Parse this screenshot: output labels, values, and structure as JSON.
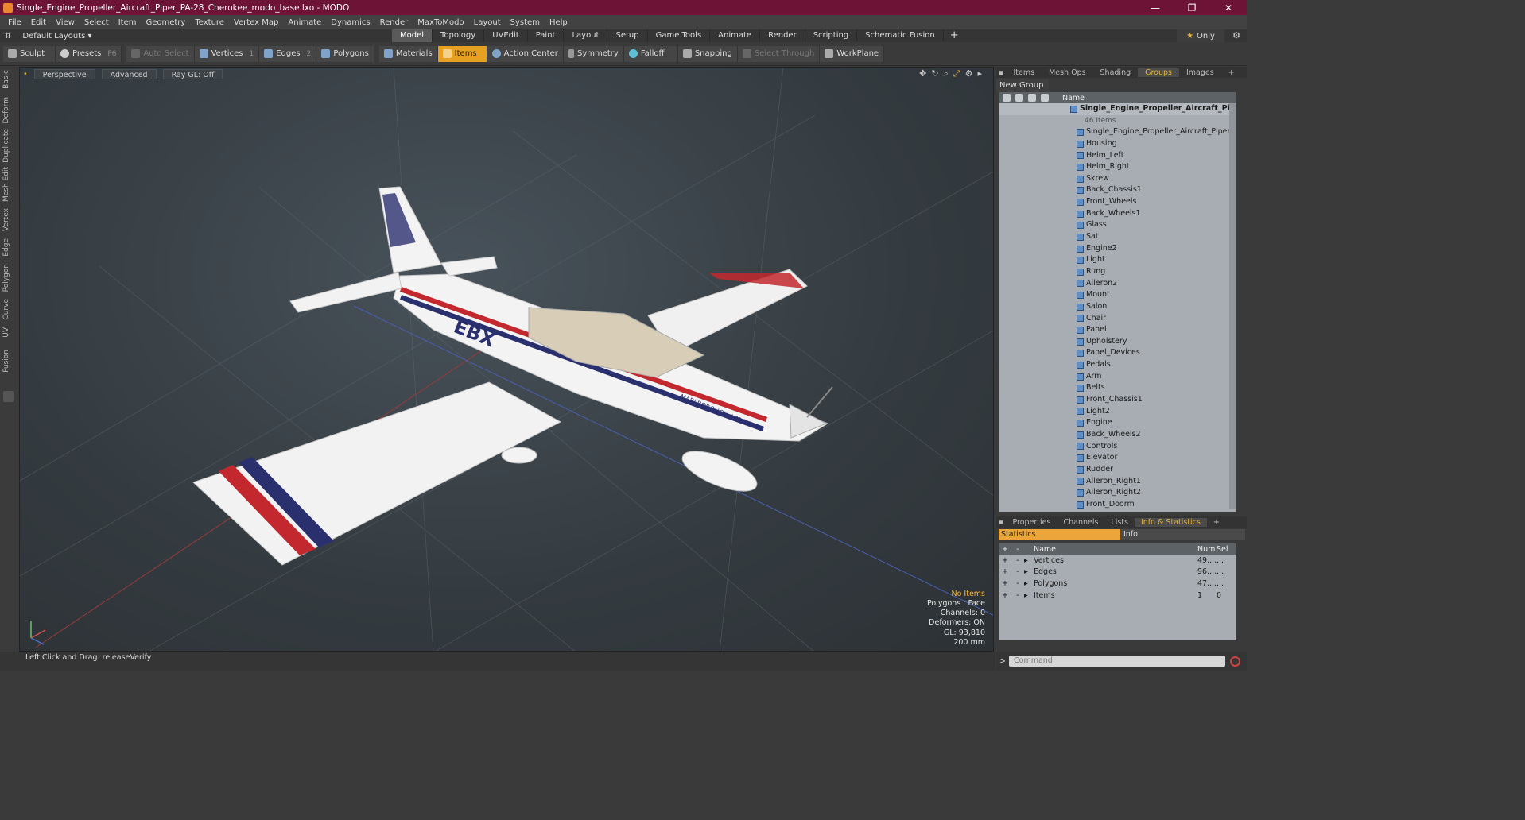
{
  "window": {
    "title": "Single_Engine_Propeller_Aircraft_Piper_PA-28_Cherokee_modo_base.lxo - MODO",
    "minimize": "—",
    "maximize": "❐",
    "close": "✕"
  },
  "menu": [
    "File",
    "Edit",
    "View",
    "Select",
    "Item",
    "Geometry",
    "Texture",
    "Vertex Map",
    "Animate",
    "Dynamics",
    "Render",
    "MaxToModo",
    "Layout",
    "System",
    "Help"
  ],
  "layouts": {
    "label": "Default Layouts ▾"
  },
  "tabs": [
    "Model",
    "Topology",
    "UVEdit",
    "Paint",
    "Layout",
    "Setup",
    "Game Tools",
    "Animate",
    "Render",
    "Scripting",
    "Schematic Fusion"
  ],
  "tab_add": "+",
  "only": {
    "star": "★",
    "label": "Only"
  },
  "toolbar": {
    "sculpt": "Sculpt",
    "presets": "Presets",
    "presets_key": "F6",
    "auto_select": "Auto Select",
    "vertices": "Vertices",
    "vertices_key": "1",
    "edges": "Edges",
    "edges_key": "2",
    "polygons": "Polygons",
    "materials": "Materials",
    "items": "Items",
    "action_center": "Action Center",
    "symmetry": "Symmetry",
    "falloff": "Falloff",
    "snapping": "Snapping",
    "select_through": "Select Through",
    "workplane": "WorkPlane"
  },
  "left_tabs": [
    "Basic",
    "Deform",
    "Duplicate",
    "Mesh Edit",
    "Vertex",
    "Edge",
    "Polygon",
    "Curve",
    "UV",
    "Fusion"
  ],
  "viewport": {
    "view": "Perspective",
    "mode": "Advanced",
    "raygl": "Ray GL: Off",
    "aircraft_reg": "EBX",
    "aircraft_club": "MARLBOROUGH AERO CLUB",
    "stats": {
      "items": "No Items",
      "polygons": "Polygons : Face",
      "channels": "Channels: 0",
      "deformers": "Deformers: ON",
      "gl": "GL: 93,810",
      "scale": "200 mm"
    }
  },
  "status": {
    "hint": "Left Click and Drag:  releaseVerify"
  },
  "panel_tabs": [
    "Items",
    "Mesh Ops",
    "Shading",
    "Groups",
    "Images"
  ],
  "panel_active": "Groups",
  "new_group": "New Group",
  "list_header": {
    "name": "Name"
  },
  "groups": {
    "root": "Single_Engine_Propeller_Aircraft_Piper ...",
    "root_count": "46 Items",
    "items": [
      "Single_Engine_Propeller_Aircraft_Piper_PA_...",
      "Housing",
      "Helm_Left",
      "Helm_Right",
      "Skrew",
      "Back_Chassis1",
      "Front_Wheels",
      "Back_Wheels1",
      "Glass",
      "Sat",
      "Engine2",
      "Light",
      "Rung",
      "Aileron2",
      "Mount",
      "Salon",
      "Chair",
      "Panel",
      "Upholstery",
      "Panel_Devices",
      "Pedals",
      "Arm",
      "Belts",
      "Front_Chassis1",
      "Light2",
      "Engine",
      "Back_Wheels2",
      "Controls",
      "Elevator",
      "Rudder",
      "Aileron_Right1",
      "Aileron_Right2",
      "Front_Doorm"
    ]
  },
  "panel_tabs2": [
    "Properties",
    "Channels",
    "Lists",
    "Info & Statistics"
  ],
  "panel2_active": "Info & Statistics",
  "stats_tabs": {
    "statistics": "Statistics",
    "info": "Info"
  },
  "stats_table": {
    "headers": {
      "name": "Name",
      "num": "Num",
      "sel": "Sel"
    },
    "rows": [
      {
        "name": "Vertices",
        "num": "49....",
        "sel": "..."
      },
      {
        "name": "Edges",
        "num": "96....",
        "sel": "..."
      },
      {
        "name": "Polygons",
        "num": "47....",
        "sel": "..."
      },
      {
        "name": "Items",
        "num": "1",
        "sel": "0"
      }
    ]
  },
  "command": {
    "prompt": ">",
    "placeholder": "Command"
  },
  "colors": {
    "titlebar": "#6d1436",
    "accent": "#eca53a",
    "active_tool": "#e8a020"
  }
}
